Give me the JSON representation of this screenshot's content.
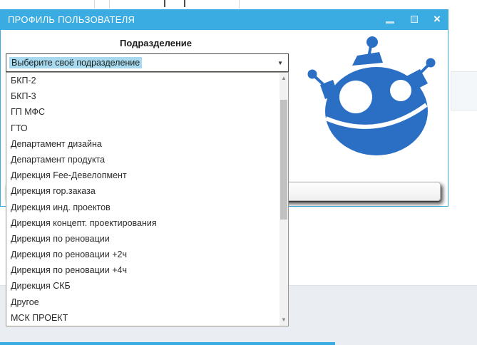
{
  "window": {
    "title": "ПРОФИЛЬ ПОЛЬЗОВАТЕЛЯ",
    "close_glyph": "×"
  },
  "form": {
    "label": "Подразделение",
    "combobox": {
      "value": "Выберите своё подразделение"
    },
    "dropdown": {
      "items": [
        "БКП-2",
        "БКП-3",
        "ГП МФС",
        "ГТО",
        "Департамент дизайна",
        "Департамент продукта",
        "Дирекция Fee-Девелопмент",
        "Дирекция гор.заказа",
        "Дирекция инд. проектов",
        "Дирекция концепт. проектирования",
        "Дирекция по реновации",
        "Дирекция по реновации +2ч",
        "Дирекция по реновации +4ч",
        "Дирекция СКБ",
        "Другое",
        "МСК ПРОЕКТ"
      ]
    }
  },
  "icons": {
    "combo_arrow": "▼",
    "scroll_up": "▲",
    "scroll_down": "▼",
    "robot": "robot-logo"
  },
  "colors": {
    "titlebar_accent": "#3AACE2",
    "robot_blue": "#2B6FC5",
    "selection_highlight": "#A9D9EE",
    "footer_band": "#EAEEF2"
  }
}
